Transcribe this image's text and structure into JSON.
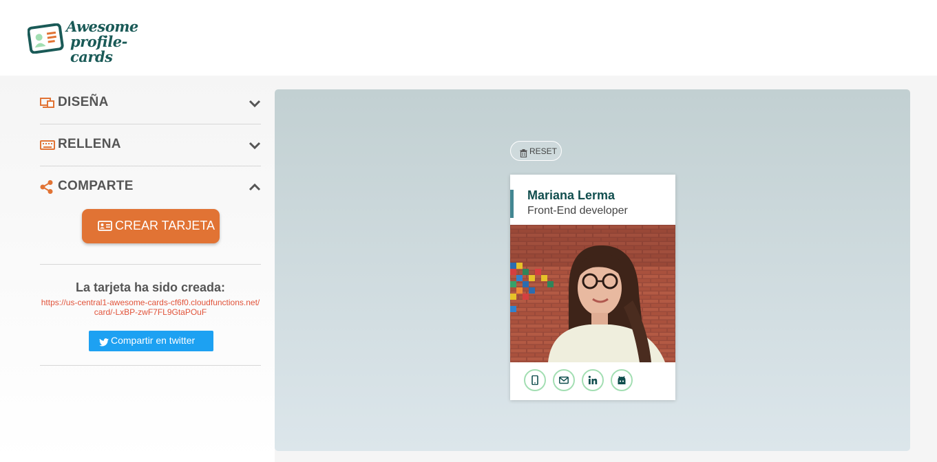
{
  "logo": {
    "line1": "Awesome",
    "line2": "profile-cards",
    "icon": "profile-card-icon"
  },
  "sections": [
    {
      "id": "disena",
      "label": "DISEÑA",
      "icon": "layout-icon",
      "expanded": false
    },
    {
      "id": "rellena",
      "label": "RELLENA",
      "icon": "keyboard-icon",
      "expanded": false
    },
    {
      "id": "comparte",
      "label": "COMPARTE",
      "icon": "share-icon",
      "expanded": true
    }
  ],
  "share": {
    "create_button_label": "CREAR TARJETA",
    "created_title": "La tarjeta ha sido creada:",
    "created_link": "https://us-central1-awesome-cards-cf6f0.cloudfunctions.net/card/-LxBP-zwF7FL9GtaPOuF",
    "twitter_button_label": "Compartir en twitter"
  },
  "preview": {
    "reset_label": "RESET",
    "card": {
      "name": "Mariana Lerma",
      "job": "Front-End developer",
      "social_icons": [
        "mobile-phone-icon",
        "envelope-icon",
        "linkedin-icon",
        "github-icon"
      ]
    }
  },
  "colors": {
    "accent_orange": "#e17334",
    "logo_green": "#1a5a57",
    "card_name": "#114e4e",
    "card_bar": "#438792",
    "social_border": "#a2deb2",
    "twitter_blue": "#1da1f2",
    "link_red": "#e1533a"
  }
}
